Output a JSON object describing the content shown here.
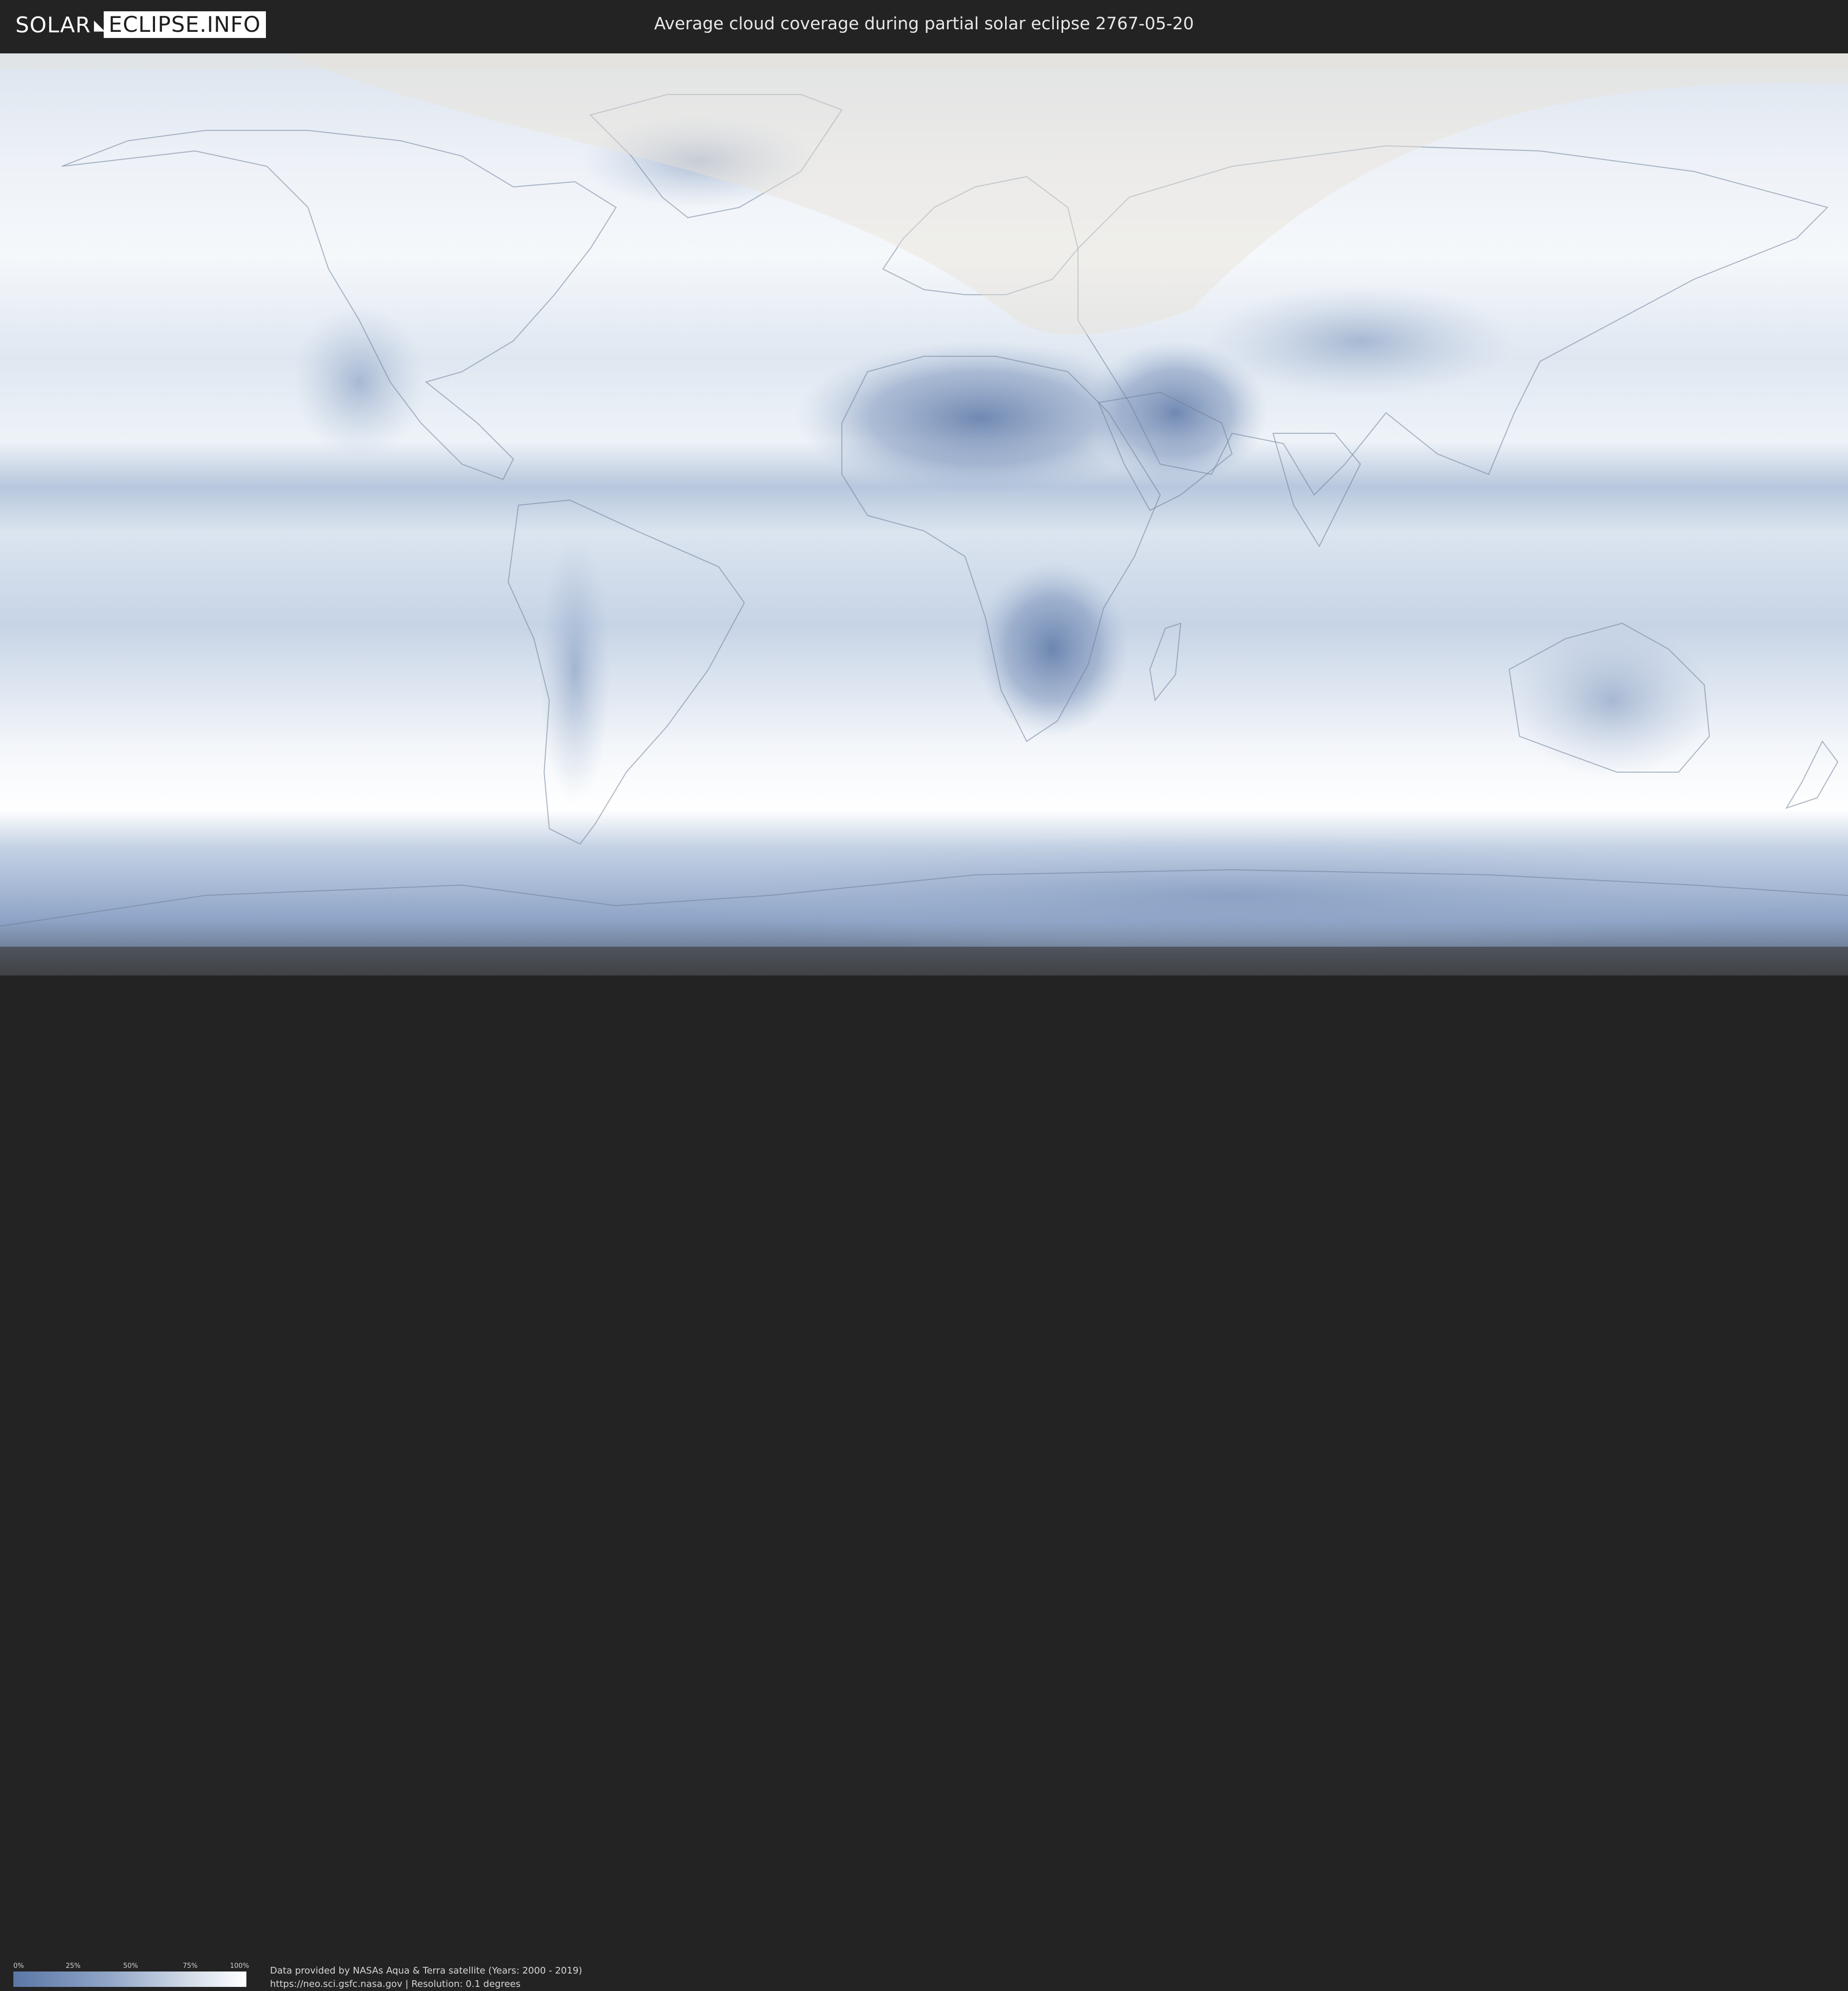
{
  "header": {
    "logo_left": "SOLAR",
    "logo_right": "ECLIPSE.INFO",
    "title": "Average cloud coverage during partial solar eclipse 2767-05-20"
  },
  "legend": {
    "ticks": [
      "0%",
      "25%",
      "50%",
      "75%",
      "100%"
    ],
    "colors": [
      "#5b77a6",
      "#8fa5c7",
      "#d2dbe8",
      "#ffffff"
    ]
  },
  "footer": {
    "credit_line1": "Data provided by NASAs Aqua & Terra satellite (Years: 2000 - 2019)",
    "credit_line2": "https://neo.sci.gsfc.nasa.gov | Resolution: 0.1 degrees"
  },
  "map": {
    "projection": "equirectangular",
    "low_cloud_color": "#5b77a6",
    "high_cloud_color": "#ffffff",
    "eclipse_overlay_color": "#e8e2d6"
  }
}
